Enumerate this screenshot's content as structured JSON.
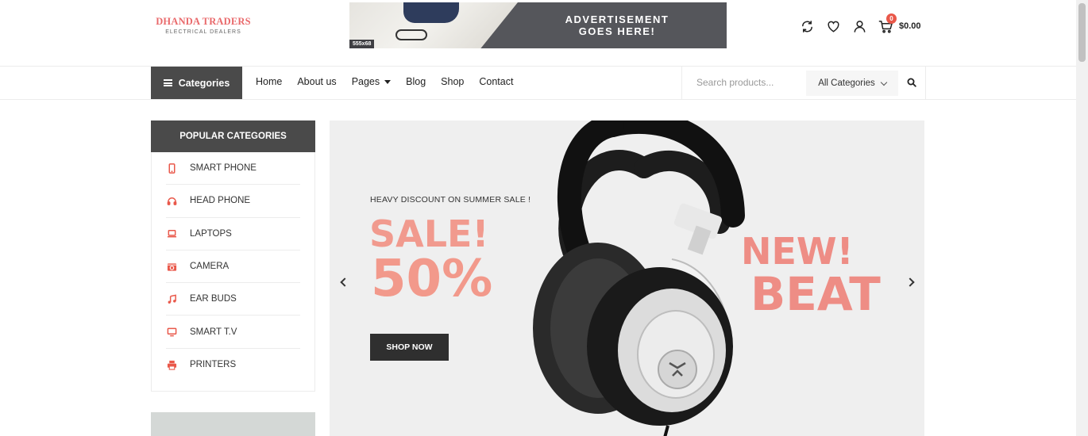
{
  "header": {
    "logo_title": "DHANDA TRADERS",
    "logo_subtitle": "ELECTRICAL DEALERS",
    "ad": {
      "size_tag": "555x68",
      "line1": "ADVERTISEMENT",
      "line2": "GOES HERE!"
    },
    "cart": {
      "count": "0",
      "total": "$0.00"
    }
  },
  "nav": {
    "categories_label": "Categories",
    "links": [
      "Home",
      "About us",
      "Pages",
      "Blog",
      "Shop",
      "Contact"
    ],
    "search_placeholder": "Search products...",
    "category_select": "All Categories"
  },
  "sidebar": {
    "title": "POPULAR CATEGORIES",
    "items": [
      {
        "label": "SMART PHONE",
        "icon": "mobile-icon"
      },
      {
        "label": "HEAD PHONE",
        "icon": "headphones-icon"
      },
      {
        "label": "LAPTOPS",
        "icon": "laptop-icon"
      },
      {
        "label": "CAMERA",
        "icon": "camera-icon"
      },
      {
        "label": "EAR BUDS",
        "icon": "music-note-icon"
      },
      {
        "label": "SMART T.V",
        "icon": "tv-icon"
      },
      {
        "label": "PRINTERS",
        "icon": "printer-icon"
      }
    ]
  },
  "hero": {
    "kicker": "HEAVY DISCOUNT ON SUMMER SALE !",
    "sale": "SALE!",
    "percent": "50%",
    "button": "SHOP NOW",
    "new": "NEW!",
    "beat": "BEAT"
  },
  "colors": {
    "accent": "#e9584a",
    "dark": "#4a4a4a",
    "sale_pink": "#f19a8e"
  }
}
